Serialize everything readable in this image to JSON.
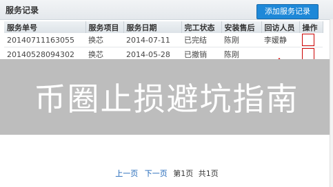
{
  "header": {
    "title": "服务记录",
    "add_button": "添加服务记录"
  },
  "table": {
    "columns": [
      "服务单号",
      "服务项目",
      "服务日期",
      "完工状态",
      "安装售后",
      "回访人员",
      "操作"
    ],
    "rows": [
      [
        "20140711163055",
        "换芯",
        "2014-07-11",
        "已完结",
        "陈刚",
        "李媛静"
      ],
      [
        "20140528094302",
        "换芯",
        "2014-05-28",
        "已撤销",
        "陈刚",
        ""
      ]
    ]
  },
  "overlay": {
    "text": "币圈止损避坑指南"
  },
  "pager": {
    "prev": "上一页",
    "next": "下一页",
    "page_info": "第1页",
    "total": "共1页"
  },
  "colors": {
    "accent": "#1e88d8",
    "link": "#1e66b8",
    "banner": "#bdbdbd"
  }
}
